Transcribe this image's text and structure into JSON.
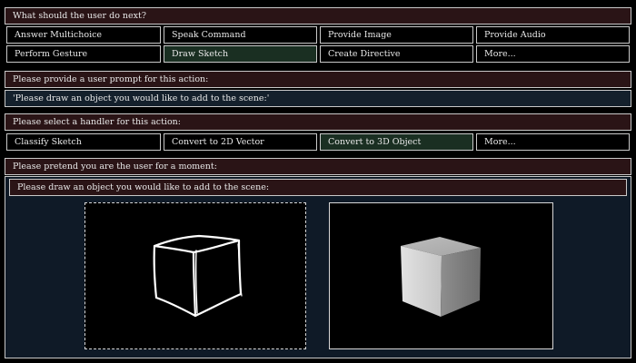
{
  "question": "What should the user do next?",
  "actions": [
    {
      "label": "Answer Multichoice",
      "selected": false
    },
    {
      "label": "Speak Command",
      "selected": false
    },
    {
      "label": "Provide Image",
      "selected": false
    },
    {
      "label": "Provide Audio",
      "selected": false
    },
    {
      "label": "Perform Gesture",
      "selected": false
    },
    {
      "label": "Draw Sketch",
      "selected": true
    },
    {
      "label": "Create Directive",
      "selected": false
    },
    {
      "label": "More...",
      "selected": false
    }
  ],
  "prompt_header": "Please provide a user prompt for this action:",
  "prompt_value": "'Please draw an object you would like to add to the scene:'",
  "handler_header": "Please select a handler for this action:",
  "handlers": [
    {
      "label": "Classify Sketch",
      "selected": false
    },
    {
      "label": "Convert to 2D Vector",
      "selected": false
    },
    {
      "label": "Convert to 3D Object",
      "selected": true
    },
    {
      "label": "More...",
      "selected": false
    }
  ],
  "pretend_header": "Please pretend you are the user for a moment:",
  "user_prompt": "Please draw an object you would like to add to the scene:",
  "colors": {
    "header_bg": "#2a1416",
    "prompt_bg": "#14202c",
    "selected_bg": "#1a2f22",
    "panel_bg": "#0f1a27"
  },
  "icons": {
    "sketch": "hand-drawn-cube-sketch",
    "render": "3d-cube-render"
  }
}
